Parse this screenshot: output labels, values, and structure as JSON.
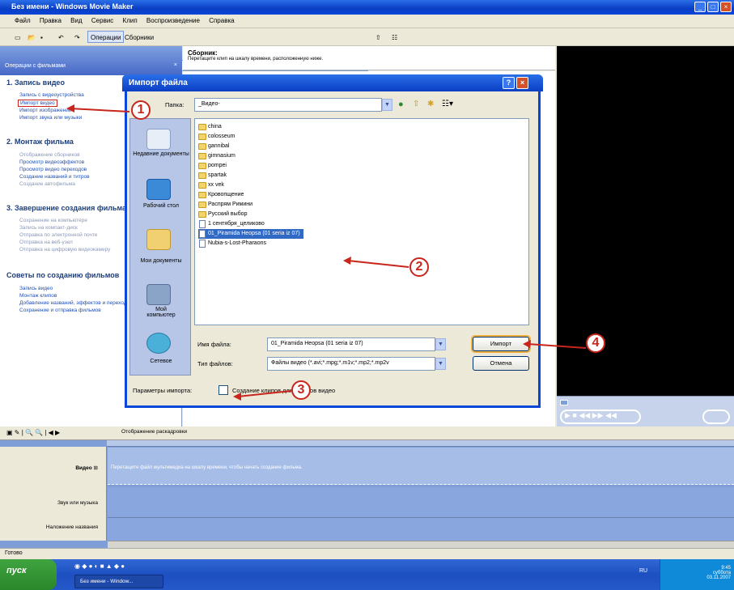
{
  "window": {
    "title": "Без имени - Windows Movie Maker"
  },
  "menu": [
    "Файл",
    "Правка",
    "Вид",
    "Сервис",
    "Клип",
    "Воспроизведение",
    "Справка"
  ],
  "toolbar": {
    "operations": "Операции",
    "collections": "Сборники"
  },
  "tasks": {
    "header": "Операции с фильмами",
    "sections": [
      {
        "title": "1. Запись видео",
        "links": [
          "Запись с видеоустройства",
          "Импорт видео",
          "Импорт изображений",
          "Импорт звука или музыки"
        ]
      },
      {
        "title": "2. Монтаж фильма",
        "links": [
          "Отображение сборников",
          "Просмотр видеоэффектов",
          "Просмотр видео переходов",
          "Создание названий и титров",
          "Создание автофильма"
        ]
      },
      {
        "title": "3. Завершение создания фильма",
        "links": [
          "Сохранение на компьютере",
          "Запись на компакт-диск",
          "Отправка по электронной почте",
          "Отправка на веб-узел",
          "Отправка на цифровую видеокамеру"
        ]
      },
      {
        "title": "Советы по созданию фильмов",
        "links": [
          "Запись видео",
          "Монтаж клипов",
          "Добавление названий, эффектов и переходов",
          "Сохранение и отправка фильмов"
        ]
      }
    ]
  },
  "collection": {
    "title": "Сборник:",
    "desc": "Перетащите клип на шкалу времени, расположенную ниже."
  },
  "dialog": {
    "title": "Импорт файла",
    "folder_label": "Папка:",
    "folder_value": "_Видео-",
    "places": [
      "Недавние документы",
      "Рабочий стол",
      "Мои документы",
      "Мой компьютер",
      "Сетевое"
    ],
    "files": [
      {
        "name": "china",
        "type": "folder"
      },
      {
        "name": "colosseum",
        "type": "folder"
      },
      {
        "name": "gannibal",
        "type": "folder"
      },
      {
        "name": "gimnasium",
        "type": "folder"
      },
      {
        "name": "pompei",
        "type": "folder"
      },
      {
        "name": "spartak",
        "type": "folder"
      },
      {
        "name": "xx vek",
        "type": "folder"
      },
      {
        "name": "Кровопщение",
        "type": "folder"
      },
      {
        "name": "Распрям Римини",
        "type": "folder"
      },
      {
        "name": "Русский выбор",
        "type": "folder"
      },
      {
        "name": "1 сентября_целиково",
        "type": "file"
      },
      {
        "name": "01_Piramida Heopsa (01 seria iz 07)",
        "type": "file",
        "selected": true
      },
      {
        "name": "Nubia-s-Lost-Pharaons",
        "type": "file"
      }
    ],
    "filename_label": "Имя файла:",
    "filename_value": "01_Piramida Heopsa (01 seria iz 07)",
    "filetype_label": "Тип файлов:",
    "filetype_value": "Файлы видео (*.avi;*.mpg;*.m1v;*.mp2;*.mp2v",
    "import_button": "Импорт",
    "cancel_button": "Отмена",
    "options_label": "Параметры импорта:",
    "checkbox_label": "Создание клипов для файлов видео"
  },
  "callouts": [
    "1",
    "2",
    "3",
    "4"
  ],
  "storyboard": {
    "toggle": "Отображение раскадровки",
    "video": "Видео",
    "audio": "Звук или музыка",
    "titles": "Наложение названия",
    "hint": "Перетащите файл мультимедиа на шкалу времени, чтобы начать создание фильма."
  },
  "status": "Готово",
  "taskbar": {
    "start": "пуск",
    "task": "Без имени - Window...",
    "lang": "RU",
    "time": "9:45",
    "day": "суббота",
    "date": "03.11.2007"
  },
  "colors": {
    "accent": "#0a46d8",
    "callout": "#c8261c"
  }
}
